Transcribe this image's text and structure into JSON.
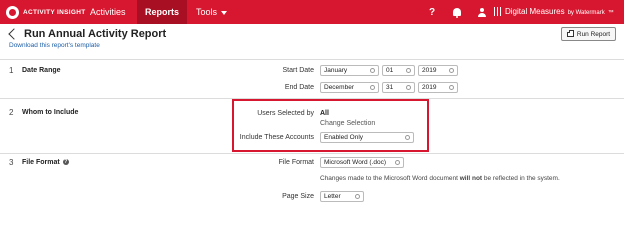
{
  "app": {
    "logo_text": "ACTIVITY INSIGHT",
    "nav": [
      {
        "label": "Activities"
      },
      {
        "label": "Reports"
      },
      {
        "label": "Tools"
      }
    ],
    "help_glyph": "?",
    "brand": "Digital Measures",
    "brand_by": "by Watermark",
    "brand_tm": "™"
  },
  "page": {
    "title": "Run Annual Activity Report",
    "download_link": "Download this report's template",
    "run_button": "Run Report"
  },
  "steps": [
    {
      "num": "1",
      "label": "Date Range"
    },
    {
      "num": "2",
      "label": "Whom to Include"
    },
    {
      "num": "3",
      "label": "File Format"
    }
  ],
  "date_range": {
    "start_label": "Start Date",
    "start_month": "January",
    "start_day": "01",
    "start_year": "2019",
    "end_label": "End Date",
    "end_month": "December",
    "end_day": "31",
    "end_year": "2019"
  },
  "whom": {
    "users_label": "Users Selected by",
    "users_value": "All",
    "change_link": "Change Selection",
    "accounts_label": "Include These Accounts",
    "accounts_value": "Enabled Only"
  },
  "format": {
    "file_format_label": "File Format",
    "file_format_value": "Microsoft Word (.doc)",
    "note_before": "Changes made to the Microsoft Word document ",
    "note_bold": "will not",
    "note_after": " be reflected in the system.",
    "page_size_label": "Page Size",
    "page_size_value": "Letter"
  },
  "colors": {
    "brand_red": "#d7172f",
    "active_tab": "#a80f22",
    "link_blue": "#1d5fa8"
  },
  "icons": [
    "activity-insight-logo-icon",
    "chevron-down-icon",
    "help-icon",
    "bell-icon",
    "user-icon",
    "back-chevron-icon",
    "printer-icon",
    "info-icon"
  ]
}
